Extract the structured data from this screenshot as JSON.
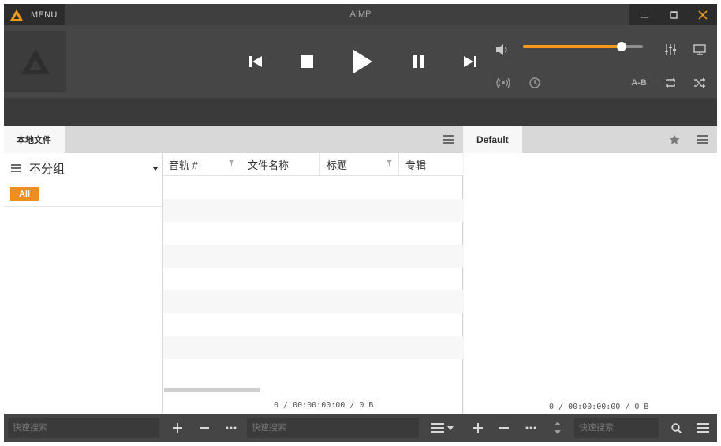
{
  "titlebar": {
    "menu_label": "MENU",
    "app_title": "AIMP"
  },
  "player": {
    "volume_percent": 82,
    "ab_label": "A-B"
  },
  "library": {
    "tab_label": "本地文件",
    "group_mode": "不分组",
    "all_tag": "All",
    "columns": [
      "音轨 #",
      "文件名称",
      "标题",
      "专辑"
    ],
    "status": "0 / 00:00:00:00 / 0 B"
  },
  "playlist": {
    "tab_label": "Default",
    "status": "0 / 00:00:00:00 / 0 B"
  },
  "bottombar": {
    "search_placeholder_1": "快速搜索",
    "search_placeholder_2": "快速搜索",
    "search_placeholder_3": "快速搜索"
  },
  "colors": {
    "accent": "#f39a1e",
    "dark_bg": "#464646",
    "titlebar": "#3f3f3f"
  },
  "icons": [
    "aimp-logo-icon",
    "minimize-icon",
    "maximize-icon",
    "close-icon",
    "previous-icon",
    "stop-icon",
    "play-icon",
    "pause-icon",
    "next-icon",
    "volume-icon",
    "equalizer-icon",
    "visualization-icon",
    "radio-icon",
    "timer-icon",
    "repeat-icon",
    "shuffle-icon",
    "menu-lines-icon",
    "star-icon",
    "dropdown-icon",
    "filter-icon",
    "plus-icon",
    "minus-icon",
    "more-icon",
    "sort-icon",
    "search-icon"
  ]
}
